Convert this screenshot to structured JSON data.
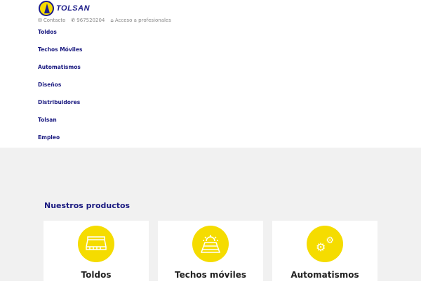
{
  "brand": {
    "name": "TOLSAN"
  },
  "topbar": [
    {
      "icon": "envelope-icon",
      "label": "Contacto"
    },
    {
      "icon": "phone-icon",
      "label": "967520204"
    },
    {
      "icon": "home-icon",
      "label": "Acceso a profesionales"
    }
  ],
  "nav": [
    "Toldos",
    "Techos Móviles",
    "Automatismos",
    "Diseños",
    "Distribuidores",
    "Tolsan",
    "Empleo"
  ],
  "products": {
    "title": "Nuestros productos",
    "items": [
      {
        "label": "Toldos",
        "icon": "awning-icon"
      },
      {
        "label": "Techos móviles",
        "icon": "sun-roof-icon"
      },
      {
        "label": "Automatismos",
        "icon": "gears-icon"
      }
    ]
  },
  "colors": {
    "accent": "#f5dc00",
    "navy": "#1a1a80"
  }
}
